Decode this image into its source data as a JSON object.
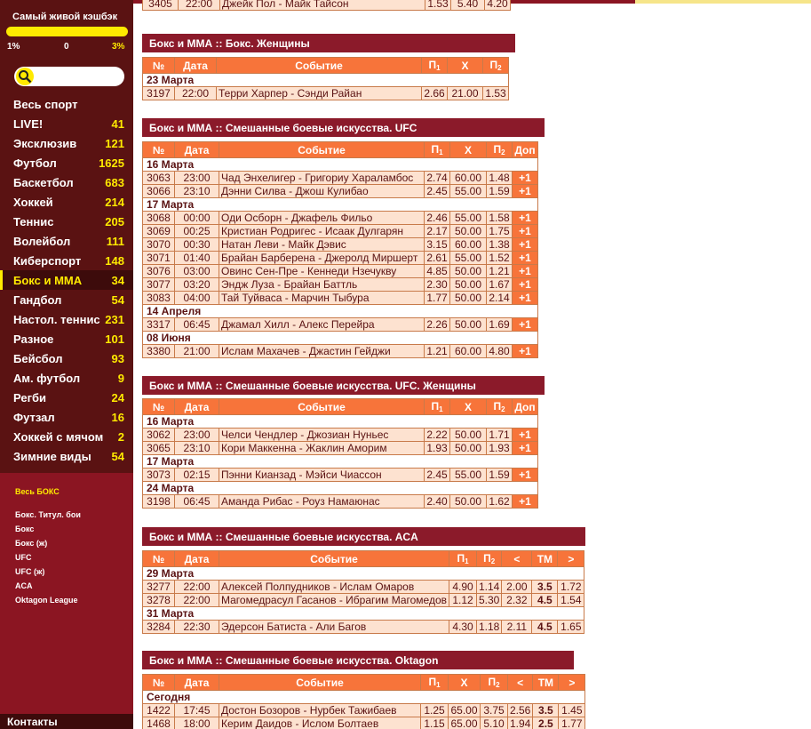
{
  "cashback": {
    "title": "Самый живой кэшбэк",
    "scale": [
      "1%",
      "0",
      "3%"
    ],
    "colors": {
      "left": "#ffffff",
      "mid": "#ffffff",
      "right": "#ffea00"
    }
  },
  "search": {
    "placeholder": ""
  },
  "sports": [
    {
      "name": "Весь спорт",
      "count": ""
    },
    {
      "name": "LIVE!",
      "count": "41"
    },
    {
      "name": "Эксклюзив",
      "count": "121"
    },
    {
      "name": "Футбол",
      "count": "1625"
    },
    {
      "name": "Баскетбол",
      "count": "683"
    },
    {
      "name": "Хоккей",
      "count": "214"
    },
    {
      "name": "Теннис",
      "count": "205"
    },
    {
      "name": "Волейбол",
      "count": "111"
    },
    {
      "name": "Киберспорт",
      "count": "148"
    },
    {
      "name": "Бокс и ММА",
      "count": "34",
      "active": true
    },
    {
      "name": "Гандбол",
      "count": "54"
    },
    {
      "name": "Настол. теннис",
      "count": "231"
    },
    {
      "name": "Разное",
      "count": "101"
    },
    {
      "name": "Бейсбол",
      "count": "93"
    },
    {
      "name": "Ам. футбол",
      "count": "9"
    },
    {
      "name": "Регби",
      "count": "24"
    },
    {
      "name": "Футзал",
      "count": "16"
    },
    {
      "name": "Хоккей с мячом",
      "count": "2"
    },
    {
      "name": "Зимние виды",
      "count": "54"
    }
  ],
  "subnav": {
    "all": "Весь БОКС",
    "items": [
      "Бокс. Титул. бои",
      "Бокс",
      "Бокс (ж)",
      "UFC",
      "UFC (ж)",
      "ACA",
      "Oktagon League"
    ]
  },
  "contacts": "Контакты",
  "colors": {
    "sidebar": "#5a1212",
    "accent": "#ffea00",
    "header": "#8b1a2a",
    "table_head": "#f7743a",
    "row": "#fde2d0"
  },
  "headers": {
    "no": "№",
    "date": "Дата",
    "event": "Событие",
    "p1": "П",
    "x": "X",
    "p2": "П",
    "dop": "Доп",
    "lt": "<",
    "tm": "ТМ",
    "gt": ">",
    "sub1": "1",
    "sub2": "2"
  },
  "sections": [
    {
      "title": "",
      "cols": "partial",
      "rows": [
        {
          "type": "ev",
          "no": "3405",
          "time": "22:00",
          "event": "Джейк Пол - Майк Тайсон",
          "p1": "1.53",
          "x": "5.40",
          "p2": "4.20"
        }
      ]
    },
    {
      "title": "Бокс и ММА :: Бокс. Женщины",
      "cols": "basic",
      "rows": [
        {
          "type": "date",
          "label": "23 Марта"
        },
        {
          "type": "ev",
          "no": "3197",
          "time": "22:00",
          "event": "Терри Харпер - Сэнди Райан",
          "p1": "2.66",
          "x": "21.00",
          "p2": "1.53"
        }
      ]
    },
    {
      "title": "Бокс и ММА :: Смешанные боевые искусства. UFC",
      "cols": "dop",
      "rows": [
        {
          "type": "date",
          "label": "16 Марта"
        },
        {
          "type": "ev",
          "no": "3063",
          "time": "23:00",
          "event": "Чад Энхелигер - Григориу Хараламбос",
          "p1": "2.74",
          "x": "60.00",
          "p2": "1.48",
          "dop": "+1"
        },
        {
          "type": "ev",
          "no": "3066",
          "time": "23:10",
          "event": "Дэнни Силва - Джош Кулибао",
          "p1": "2.45",
          "x": "55.00",
          "p2": "1.59",
          "dop": "+1"
        },
        {
          "type": "date",
          "label": "17 Марта"
        },
        {
          "type": "ev",
          "no": "3068",
          "time": "00:00",
          "event": "Оди Осборн - Джафель Фильо",
          "p1": "2.46",
          "x": "55.00",
          "p2": "1.58",
          "dop": "+1"
        },
        {
          "type": "ev",
          "no": "3069",
          "time": "00:25",
          "event": "Кристиан Родригес - Исаак Дулгарян",
          "p1": "2.17",
          "x": "50.00",
          "p2": "1.75",
          "dop": "+1"
        },
        {
          "type": "ev",
          "no": "3070",
          "time": "00:30",
          "event": "Натан Леви - Майк Дэвис",
          "p1": "3.15",
          "x": "60.00",
          "p2": "1.38",
          "dop": "+1"
        },
        {
          "type": "ev",
          "no": "3071",
          "time": "01:40",
          "event": "Брайан Барберена - Джеролд Миршерт",
          "p1": "2.61",
          "x": "55.00",
          "p2": "1.52",
          "dop": "+1"
        },
        {
          "type": "ev",
          "no": "3076",
          "time": "03:00",
          "event": "Овинс Сен-Пре - Кеннеди Нзечукву",
          "p1": "4.85",
          "x": "50.00",
          "p2": "1.21",
          "dop": "+1"
        },
        {
          "type": "ev",
          "no": "3077",
          "time": "03:20",
          "event": "Эндж Луза - Брайан Баттль",
          "p1": "2.30",
          "x": "50.00",
          "p2": "1.67",
          "dop": "+1"
        },
        {
          "type": "ev",
          "no": "3083",
          "time": "04:00",
          "event": "Тай Туйваса - Марчин Тыбура",
          "p1": "1.77",
          "x": "50.00",
          "p2": "2.14",
          "dop": "+1"
        },
        {
          "type": "date",
          "label": "14 Апреля"
        },
        {
          "type": "ev",
          "no": "3317",
          "time": "06:45",
          "event": "Джамал Хилл - Алекс Перейра",
          "p1": "2.26",
          "x": "50.00",
          "p2": "1.69",
          "dop": "+1"
        },
        {
          "type": "date",
          "label": "08 Июня"
        },
        {
          "type": "ev",
          "no": "3380",
          "time": "21:00",
          "event": "Ислам Махачев - Джастин Гейджи",
          "p1": "1.21",
          "x": "60.00",
          "p2": "4.80",
          "dop": "+1"
        }
      ]
    },
    {
      "title": "Бокс и ММА :: Смешанные боевые искусства. UFC. Женщины",
      "cols": "dop",
      "rows": [
        {
          "type": "date",
          "label": "16 Марта"
        },
        {
          "type": "ev",
          "no": "3062",
          "time": "23:00",
          "event": "Челси Чендлер - Джозиан Нуньес",
          "p1": "2.22",
          "x": "50.00",
          "p2": "1.71",
          "dop": "+1"
        },
        {
          "type": "ev",
          "no": "3065",
          "time": "23:10",
          "event": "Кори Маккенна - Жаклин Аморим",
          "p1": "1.93",
          "x": "50.00",
          "p2": "1.93",
          "dop": "+1"
        },
        {
          "type": "date",
          "label": "17 Марта"
        },
        {
          "type": "ev",
          "no": "3073",
          "time": "02:15",
          "event": "Пэнни Кианзад - Мэйси Чиассон",
          "p1": "2.45",
          "x": "55.00",
          "p2": "1.59",
          "dop": "+1"
        },
        {
          "type": "date",
          "label": "24 Марта"
        },
        {
          "type": "ev",
          "no": "3198",
          "time": "06:45",
          "event": "Аманда Рибас - Роуз Намаюнас",
          "p1": "2.40",
          "x": "50.00",
          "p2": "1.62",
          "dop": "+1"
        }
      ]
    },
    {
      "title": "Бокс и ММА :: Смешанные боевые искусства. ACA",
      "cols": "aca",
      "rows": [
        {
          "type": "date",
          "label": "29 Марта"
        },
        {
          "type": "ev",
          "no": "3277",
          "time": "22:00",
          "event": "Алексей Полпудников - Ислам Омаров",
          "p1": "4.90",
          "p2": "1.14",
          "lt": "2.00",
          "tm": "3.5",
          "gt": "1.72"
        },
        {
          "type": "ev",
          "no": "3278",
          "time": "22:00",
          "event": "Магомедрасул Гасанов - Ибрагим Магомедов",
          "p1": "1.12",
          "p2": "5.30",
          "lt": "2.32",
          "tm": "4.5",
          "gt": "1.54"
        },
        {
          "type": "date",
          "label": "31 Марта"
        },
        {
          "type": "ev",
          "no": "3284",
          "time": "22:30",
          "event": "Эдерсон Батиста - Али Багов",
          "p1": "4.30",
          "p2": "1.18",
          "lt": "2.11",
          "tm": "4.5",
          "gt": "1.65"
        }
      ]
    },
    {
      "title": "Бокс и ММА :: Смешанные боевые искусства. Oktagon",
      "cols": "okt",
      "rows": [
        {
          "type": "date",
          "label": "Сегодня"
        },
        {
          "type": "ev",
          "no": "1422",
          "time": "17:45",
          "event": "Достон Бозоров - Нурбек Тажибаев",
          "p1": "1.25",
          "x": "65.00",
          "p2": "3.75",
          "lt": "2.56",
          "tm": "3.5",
          "gt": "1.45"
        },
        {
          "type": "ev",
          "no": "1468",
          "time": "18:00",
          "event": "Керим Даидов - Ислом Болтаев",
          "p1": "1.15",
          "x": "65.00",
          "p2": "5.10",
          "lt": "1.94",
          "tm": "2.5",
          "gt": "1.77"
        }
      ]
    }
  ]
}
